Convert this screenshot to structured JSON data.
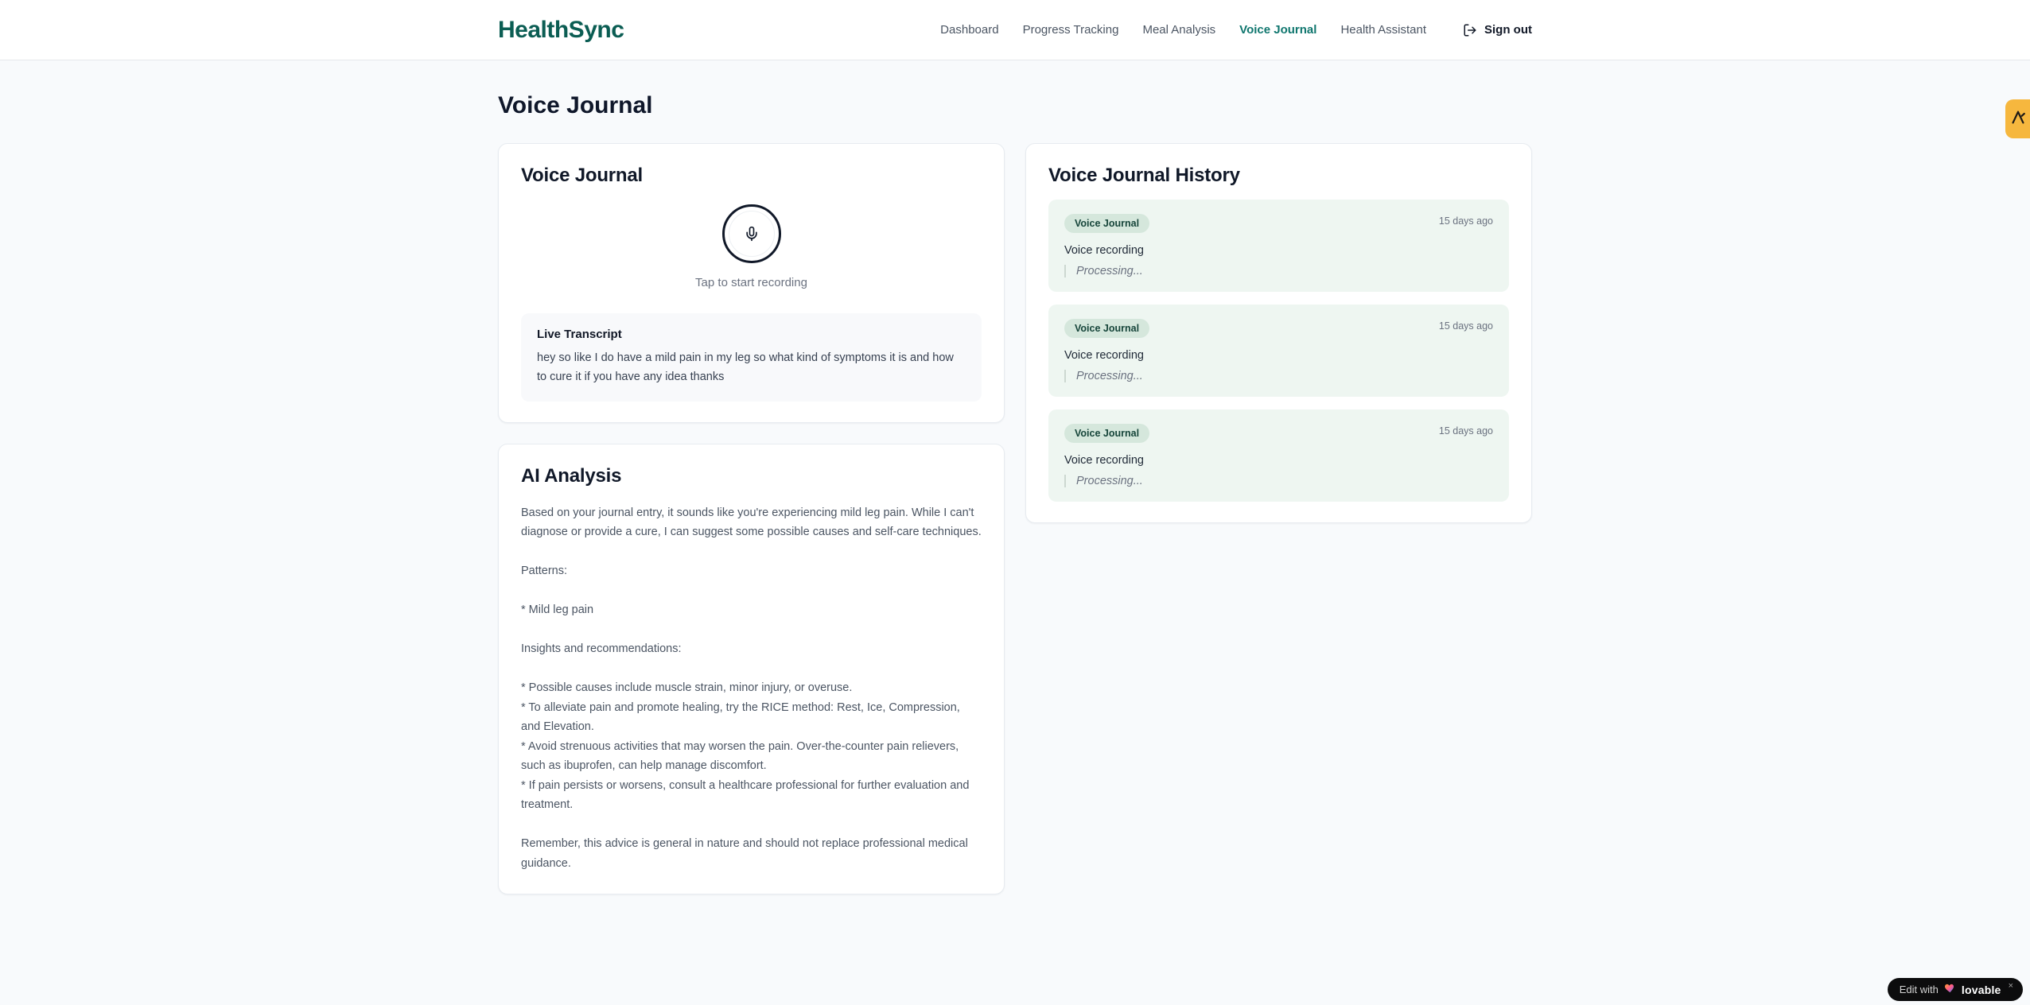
{
  "header": {
    "logo": "HealthSync",
    "nav": [
      {
        "label": "Dashboard",
        "active": false
      },
      {
        "label": "Progress Tracking",
        "active": false
      },
      {
        "label": "Meal Analysis",
        "active": false
      },
      {
        "label": "Voice Journal",
        "active": true
      },
      {
        "label": "Health Assistant",
        "active": false
      }
    ],
    "sign_out_label": "Sign out"
  },
  "page": {
    "title": "Voice Journal"
  },
  "recorder_card": {
    "title": "Voice Journal",
    "tap_hint": "Tap to start recording",
    "live_transcript": {
      "title": "Live Transcript",
      "text": "hey so like I do have a mild pain in my leg so what kind of symptoms it is and how to cure it if you have any idea thanks"
    }
  },
  "analysis_card": {
    "title": "AI Analysis",
    "body": "Based on your journal entry, it sounds like you're experiencing mild leg pain. While I can't diagnose or provide a cure, I can suggest some possible causes and self-care techniques.\n\nPatterns:\n\n* Mild leg pain\n\nInsights and recommendations:\n\n* Possible causes include muscle strain, minor injury, or overuse.\n* To alleviate pain and promote healing, try the RICE method: Rest, Ice, Compression, and Elevation.\n* Avoid strenuous activities that may worsen the pain. Over-the-counter pain relievers, such as ibuprofen, can help manage discomfort.\n* If pain persists or worsens, consult a healthcare professional for further evaluation and treatment.\n\nRemember, this advice is general in nature and should not replace professional medical guidance."
  },
  "history_card": {
    "title": "Voice Journal History",
    "entries": [
      {
        "badge": "Voice Journal",
        "time": "15 days ago",
        "title": "Voice recording",
        "status": "Processing..."
      },
      {
        "badge": "Voice Journal",
        "time": "15 days ago",
        "title": "Voice recording",
        "status": "Processing..."
      },
      {
        "badge": "Voice Journal",
        "time": "15 days ago",
        "title": "Voice recording",
        "status": "Processing..."
      }
    ]
  },
  "lovable_badge": {
    "prefix": "Edit with",
    "brand": "lovable",
    "close": "×"
  },
  "icons": {
    "microphone": "microphone-icon",
    "log_out": "log-out-icon",
    "heart": "gradient-heart-icon",
    "edge_logo": "lambda-logo-icon"
  },
  "colors": {
    "accent_teal": "#0f766e",
    "logo_teal": "#0b5d53",
    "entry_bg": "#eef6f1",
    "badge_bg": "#d5e7dc",
    "badge_text": "#16453a",
    "edge_button_orange": "#f6b73e",
    "page_bg": "#f8fafc"
  }
}
